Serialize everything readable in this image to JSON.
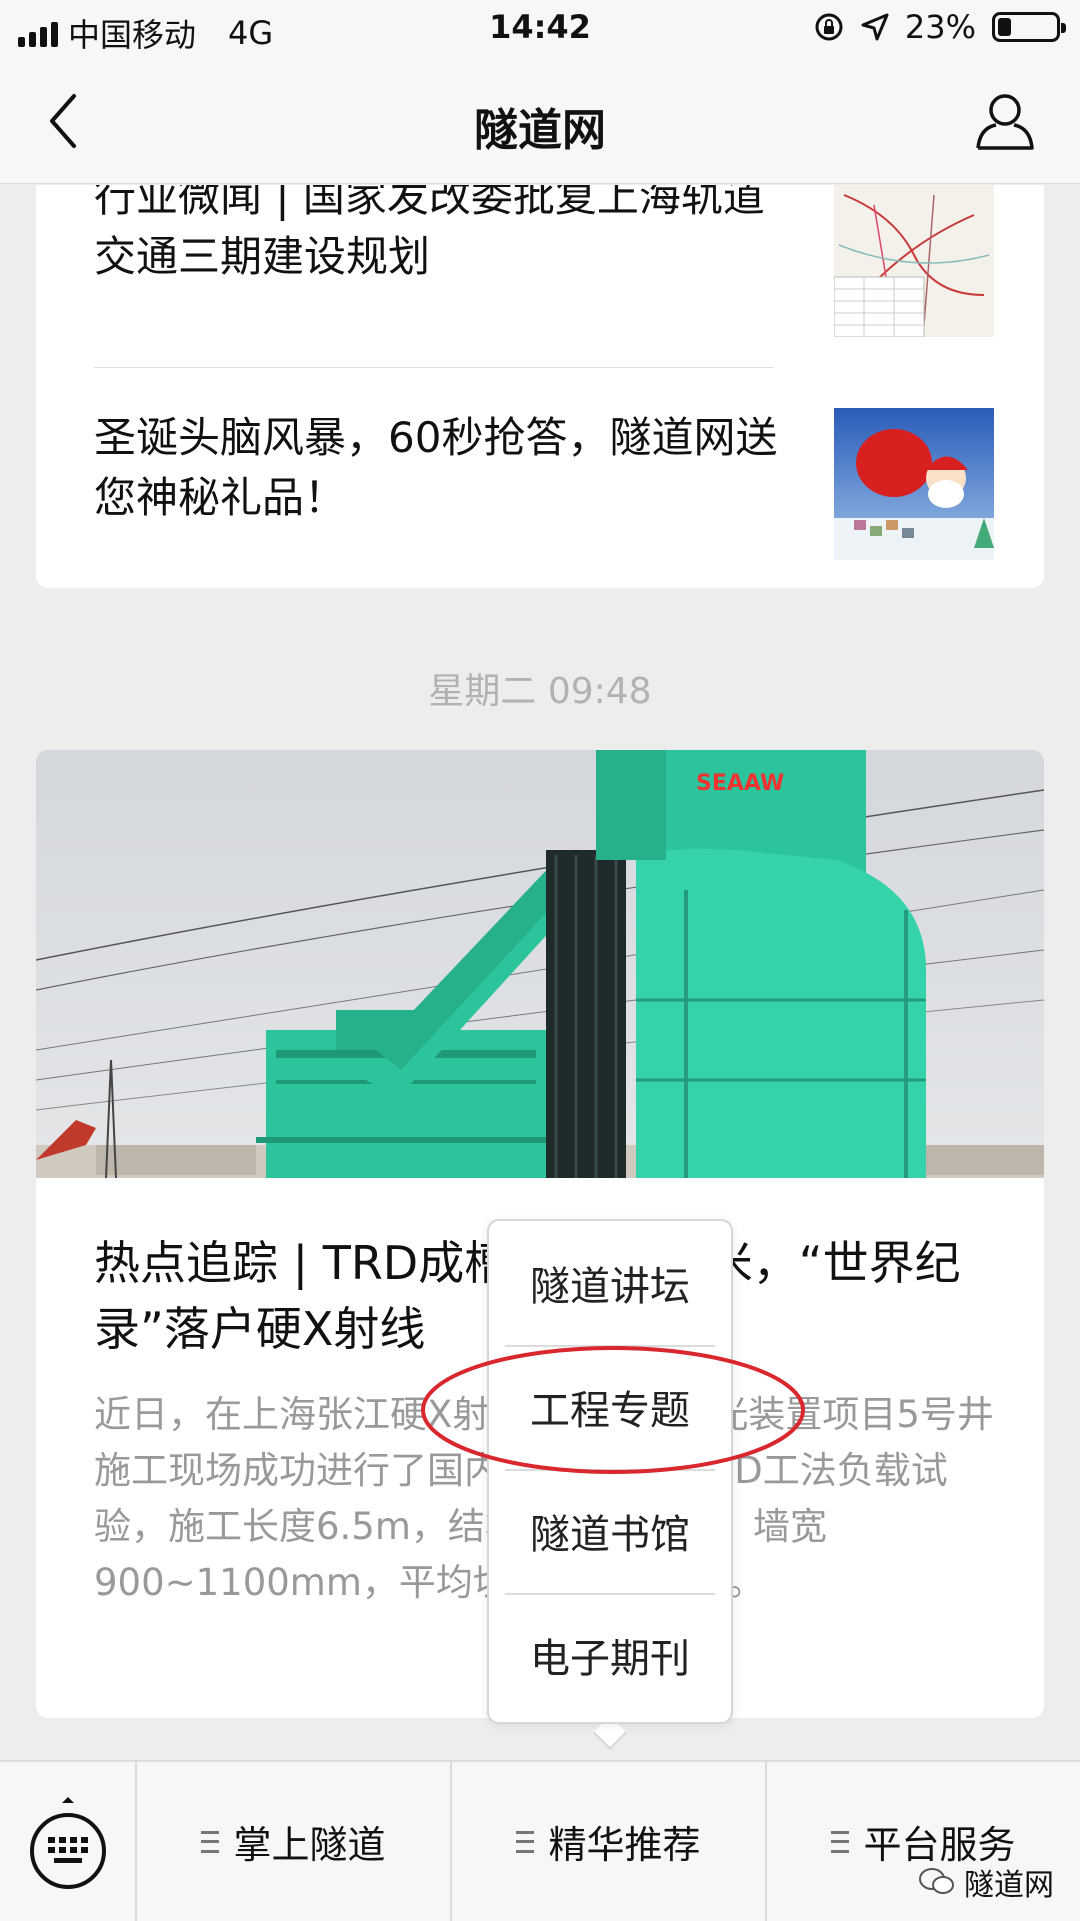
{
  "status_bar": {
    "carrier": "中国移动",
    "network": "4G",
    "time": "14:42",
    "battery_percent": "23%",
    "battery_level": 0.23
  },
  "nav": {
    "title": "隧道网",
    "back_icon": "chevron-left-icon",
    "profile_icon": "person-icon"
  },
  "feed": {
    "top_items": [
      {
        "title": "行业微闻 | 国家发改委批复上海轨道交通三期建设规划"
      },
      {
        "title": "圣诞头脑风暴，60秒抢答，隧道网送您神秘礼品！"
      }
    ],
    "date_label": "星期二 09:48",
    "main_article": {
      "title": "热点追踪 | TRD成槽深度达86米，“世界纪录”落户硬X射线",
      "summary": "近日，在上海张江硬X射线自由电子激光装置项目5号井施工现场成功进行了国内最大深度的TRD工法负载试验，施工长度6.5m，结构深度达86m，墙宽900~1100mm，平均切1m仅耗时4h。",
      "hero_logo": "SEAAW"
    }
  },
  "popup_menu": {
    "items": [
      "隧道讲坛",
      "工程专题",
      "隧道书馆",
      "电子期刊"
    ],
    "highlighted_item": "工程专题",
    "highlight_color": "#d9272e"
  },
  "bottom_menu": {
    "keyboard_icon": "keyboard-icon",
    "items": [
      "掌上隧道",
      "精华推荐",
      "平台服务"
    ]
  },
  "watermark": "隧道网",
  "colors": {
    "background": "#ededed",
    "nav_background": "#f7f7f7",
    "machine_green": "#2cc49d",
    "summary_text": "#999999"
  }
}
